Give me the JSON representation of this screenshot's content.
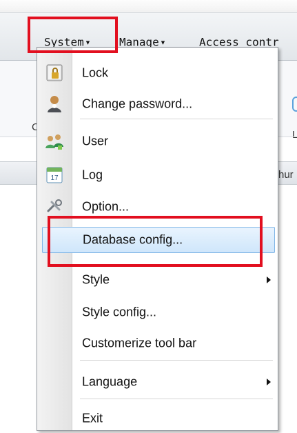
{
  "menubar": {
    "items": [
      {
        "label": "System"
      },
      {
        "label": "Manage"
      },
      {
        "label": "Access contr"
      }
    ]
  },
  "toolbar": {
    "left_stub": "C",
    "right_stub": "L"
  },
  "tabbar": {
    "right_stub": "hur"
  },
  "dropdown": {
    "items": [
      {
        "label": "Lock",
        "icon": "lock-icon"
      },
      {
        "label": "Change password...",
        "icon": "user-key-icon"
      },
      {
        "label": "User",
        "icon": "users-icon"
      },
      {
        "label": "Log",
        "icon": "calendar-icon"
      },
      {
        "label": "Option...",
        "icon": "tools-icon"
      },
      {
        "label": "Database config...",
        "icon": "",
        "highlighted": true
      },
      {
        "label": "Style",
        "icon": "",
        "submenu": true
      },
      {
        "label": "Style config...",
        "icon": ""
      },
      {
        "label": "Customerize tool bar",
        "icon": ""
      },
      {
        "label": "Language",
        "icon": "",
        "submenu": true
      },
      {
        "label": "Exit",
        "icon": ""
      }
    ]
  },
  "colors": {
    "annotation_red": "#e20f1f",
    "hover_blue_border": "#7fb5e6"
  }
}
